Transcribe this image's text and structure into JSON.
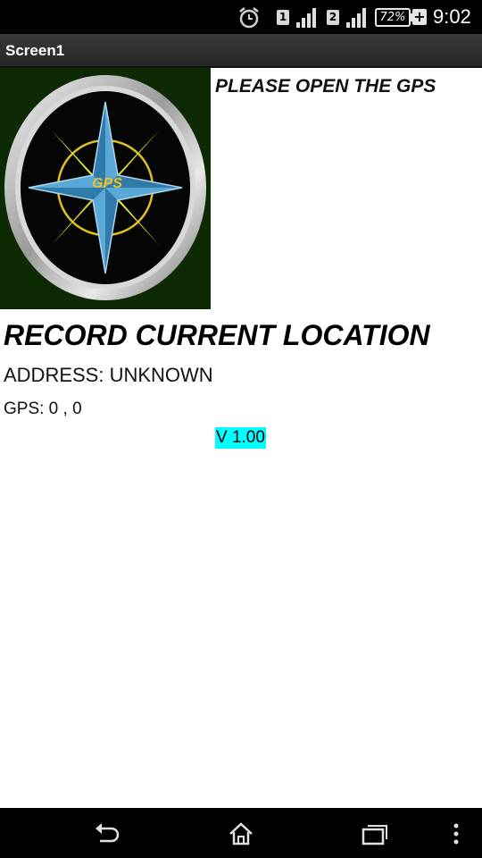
{
  "status_bar": {
    "alarm_icon": "alarm-clock-icon",
    "sim1_label": "1",
    "sim2_label": "2",
    "signal_icon": "signal-bars-icon",
    "battery_percent": "72%",
    "charging_icon": "plus-icon",
    "time": "9:02"
  },
  "title_bar": {
    "title": "Screen1"
  },
  "logo": {
    "text": "GPS",
    "icon": "compass-rose-icon",
    "colors": {
      "background": "#0e2a05",
      "star": "#3f8fc0",
      "accent": "#e6e63a",
      "text": "#f0c020"
    }
  },
  "main": {
    "gps_prompt": "PLEASE OPEN THE GPS",
    "record_label": "RECORD CURRENT LOCATION",
    "address_text": "ADDRESS: UNKNOWN",
    "gps_text": "GPS: 0 , 0",
    "version_text": "V 1.00",
    "version_bg": "#00ffff"
  },
  "nav_bar": {
    "back_icon": "back-arrow-icon",
    "home_icon": "home-icon",
    "recent_icon": "recent-apps-icon",
    "menu_icon": "overflow-menu-icon"
  }
}
